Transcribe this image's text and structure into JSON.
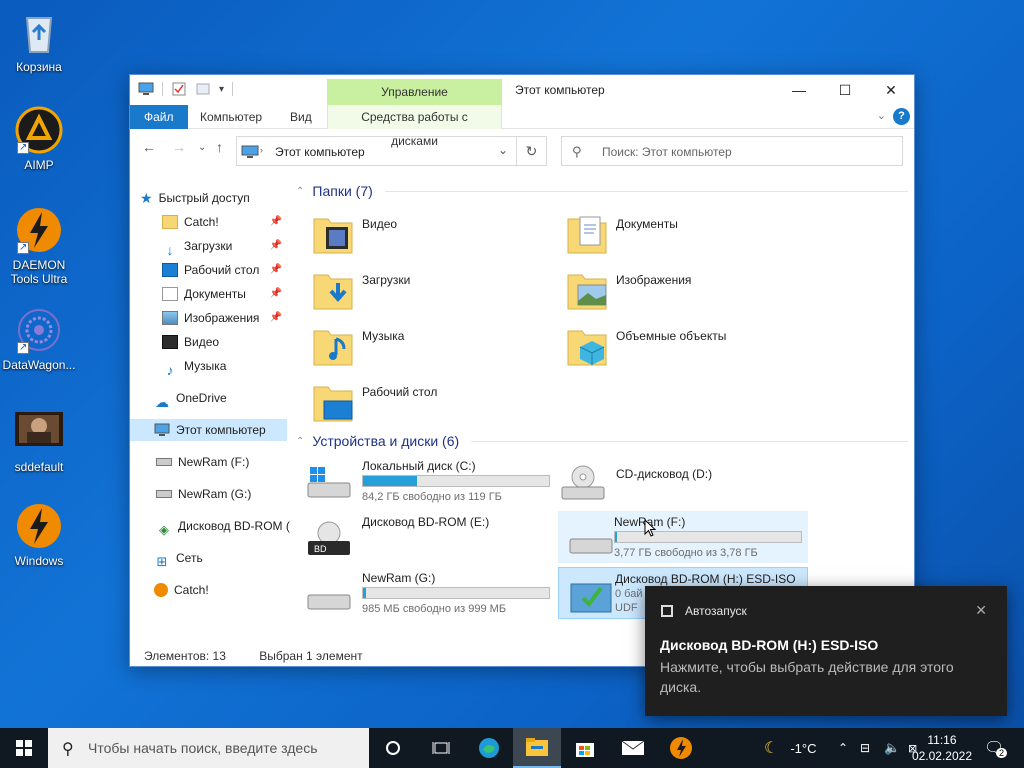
{
  "desktop": {
    "icons": [
      {
        "label": "Корзина"
      },
      {
        "label": "AIMP"
      },
      {
        "label": "DAEMON Tools Ultra"
      },
      {
        "label": "DataWagon..."
      },
      {
        "label": "sddefault"
      },
      {
        "label": "Windows"
      }
    ]
  },
  "window": {
    "title": "Этот компьютер",
    "context_group": "Управление",
    "tabs": [
      "Файл",
      "Компьютер",
      "Вид",
      "Средства работы с дисками"
    ],
    "address": "Этот компьютер",
    "search_placeholder": "Поиск: Этот компьютер",
    "nav": {
      "quick_access": "Быстрый доступ",
      "quick_items": [
        "Catch!",
        "Загрузки",
        "Рабочий стол",
        "Документы",
        "Изображения",
        "Видео",
        "Музыка"
      ],
      "onedrive": "OneDrive",
      "this_pc": "Этот компьютер",
      "drives": [
        "NewRam (F:)",
        "NewRam (G:)",
        "Дисковод BD-ROM ("
      ],
      "network": "Сеть",
      "catch": "Catch!"
    },
    "groups": {
      "folders_title": "Папки (7)",
      "devices_title": "Устройства и диски (6)"
    },
    "folders": [
      "Видео",
      "Документы",
      "Загрузки",
      "Изображения",
      "Музыка",
      "Объемные объекты",
      "Рабочий стол"
    ],
    "drives": [
      {
        "name": "Локальный диск (C:)",
        "sub": "84,2 ГБ свободно из 119 ГБ",
        "used_fraction": 0.29
      },
      {
        "name": "CD-дисковод (D:)",
        "sub": "",
        "used_fraction": null
      },
      {
        "name": "Дисковод BD-ROM (E:)",
        "sub": "",
        "used_fraction": null
      },
      {
        "name": "NewRam (F:)",
        "sub": "3,77 ГБ свободно из 3,78 ГБ",
        "used_fraction": 0.003
      },
      {
        "name": "NewRam (G:)",
        "sub": "985 МБ свободно из 999 МБ",
        "used_fraction": 0.014
      },
      {
        "name": "Дисковод BD-ROM (H:) ESD-ISO",
        "sub": "0 бай",
        "sub2": "UDF",
        "used_fraction": null
      }
    ],
    "status_count": "Элементов: 13",
    "status_selected": "Выбран 1 элемент"
  },
  "toast": {
    "app": "Автозапуск",
    "title": "Дисковод BD-ROM (H:) ESD-ISO",
    "body": "Нажмите, чтобы выбрать действие для этого диска."
  },
  "taskbar": {
    "search_placeholder": "Чтобы начать поиск, введите здесь",
    "temperature": "-1°C",
    "time": "11:16",
    "date": "02.02.2022",
    "notifications": "2"
  }
}
